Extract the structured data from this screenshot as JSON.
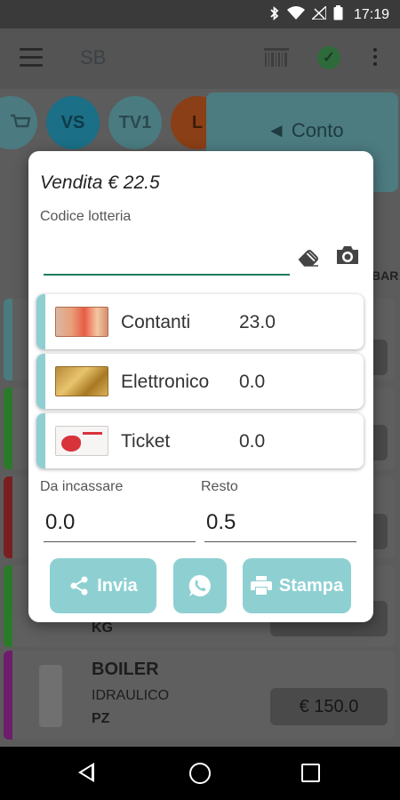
{
  "status_bar": {
    "time": "17:19"
  },
  "app_bar": {
    "title": "SB"
  },
  "background": {
    "chips": [
      {
        "label": "",
        "color": "#4b7b80"
      },
      {
        "label": "VS",
        "color": "#1b6f86"
      },
      {
        "label": "TV1",
        "color": "#4a7b80"
      },
      {
        "label": "L",
        "color": "#8a3f16"
      }
    ],
    "conto_label": "◄ Conto",
    "list_header": "BAR",
    "row_kg": "KG",
    "item": {
      "name": "BOILER",
      "category": "IDRAULICO",
      "unit": "PZ",
      "price": "€ 150.0"
    }
  },
  "dialog": {
    "title": "Vendita € 22.5",
    "lottery_label": "Codice lotteria",
    "lottery_value": "",
    "payments": [
      {
        "label": "Contanti",
        "value": "23.0",
        "thumb": "cash"
      },
      {
        "label": "Elettronico",
        "value": "0.0",
        "thumb": "card"
      },
      {
        "label": "Ticket",
        "value": "0.0",
        "thumb": "ticket"
      }
    ],
    "da_incassare_label": "Da incassare",
    "da_incassare_value": "0.0",
    "resto_label": "Resto",
    "resto_value": "0.5",
    "buttons": {
      "send": "Invia",
      "print": "Stampa"
    }
  },
  "colors": {
    "accent": "#8ed0d2",
    "input_underline": "#1e7b5e"
  }
}
